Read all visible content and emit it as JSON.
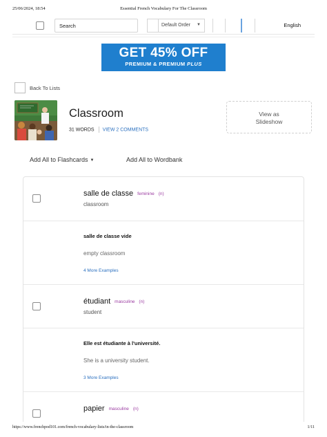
{
  "print": {
    "datetime": "25/06/2024, 18:54",
    "title": "Essential French Vocabulary For The Classroom",
    "url": "https://www.frenchpod101.com/french-vocabulary-lists/in-the-classroom",
    "page": "1/11"
  },
  "toolbar": {
    "search_label": "Search",
    "sort_selected": "Default Order",
    "language": "English"
  },
  "promo": {
    "headline": "GET 45% OFF",
    "sub_prefix": "PREMIUM & PREMIUM ",
    "sub_emph": "PLUS",
    "bg_color": "#1f7fce"
  },
  "nav": {
    "back_label": "Back To Lists"
  },
  "list": {
    "title": "Classroom",
    "word_count": "31 WORDS",
    "comments_link": "VIEW 2 COMMENTS",
    "slideshow_line1": "View as",
    "slideshow_line2": "Slideshow"
  },
  "actions": {
    "flashcards": "Add All to Flashcards",
    "wordbank": "Add All to Wordbank"
  },
  "entries": [
    {
      "word": "salle de classe",
      "gender": "feminine",
      "pos": "(n)",
      "translation": "classroom",
      "example_fr": "salle de classe vide",
      "example_en": "empty classroom",
      "more_examples": "4 More Examples"
    },
    {
      "word": "étudiant",
      "gender": "masculine",
      "pos": "(n)",
      "translation": "student",
      "example_fr": "Elle est étudiante à l'université.",
      "example_en": "She is a university student.",
      "more_examples": "3 More Examples"
    },
    {
      "word": "papier",
      "gender": "masculine",
      "pos": "(n)"
    }
  ],
  "colors": {
    "link": "#2a6fbf",
    "gender": "#9a3aa0"
  }
}
